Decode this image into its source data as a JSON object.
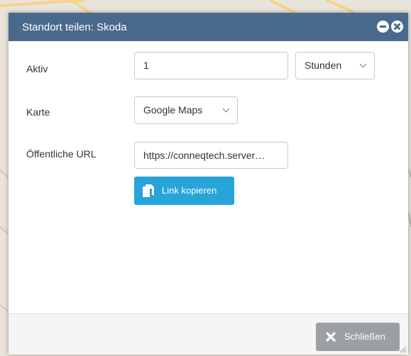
{
  "dialog": {
    "title": "Standort teilen: Skoda",
    "aktiv_label": "Aktiv",
    "aktiv_value": "1",
    "aktiv_unit": "Stunden",
    "karte_label": "Karte",
    "karte_value": "Google Maps",
    "url_label": "Öffentliche URL",
    "url_value": "https://conneqtech.server…",
    "copy_button": "Link kopieren",
    "close_button": "Schließen"
  },
  "colors": {
    "titlebar": "#4a6a8d",
    "copy_button": "#27a4d8",
    "close_button": "#9aa0a3"
  }
}
